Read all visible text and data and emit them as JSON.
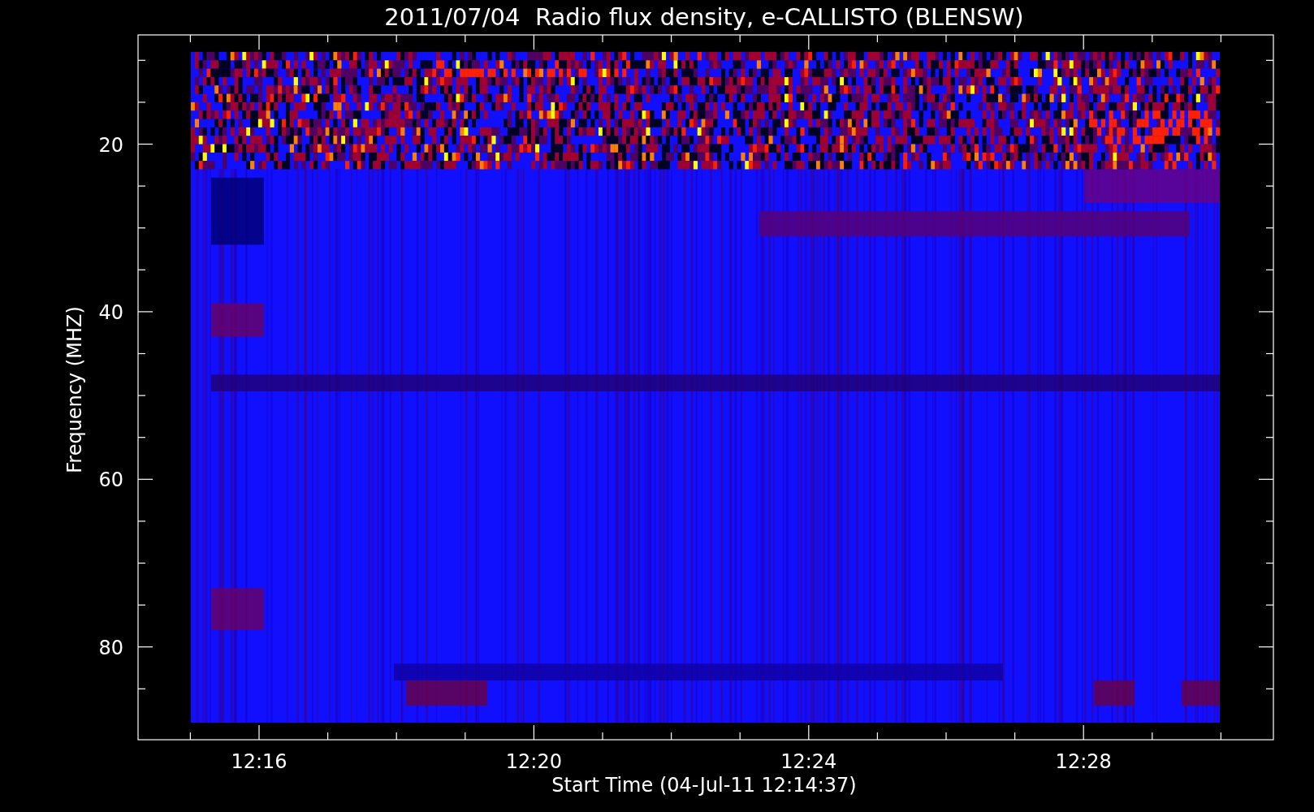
{
  "title": "2011/07/04  Radio flux density, e-CALLISTO (BLENSW)",
  "plot": {
    "xlabel": "Start Time (04-Jul-11 12:14:37)",
    "ylabel": "Frequency (MHZ)",
    "xticks": [
      "12:16",
      "12:20",
      "12:24",
      "12:28"
    ],
    "yticks": [
      "20",
      "40",
      "60",
      "80"
    ]
  }
}
